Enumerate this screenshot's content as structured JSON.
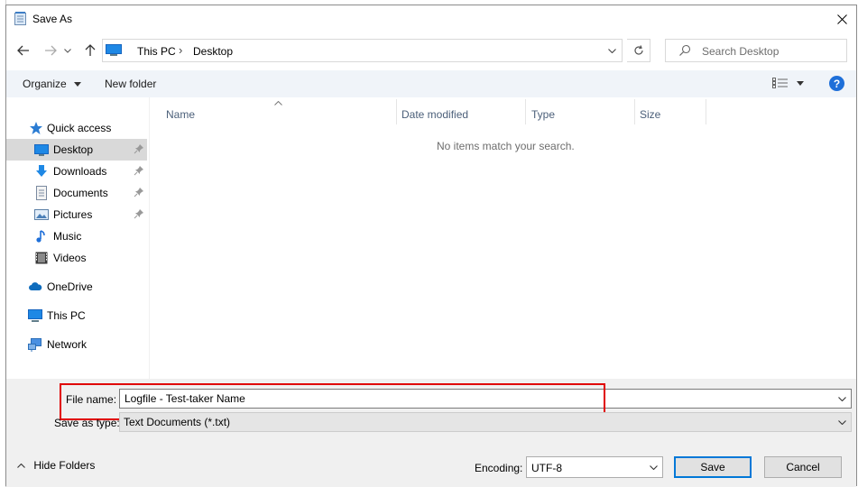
{
  "window": {
    "title": "Save As"
  },
  "nav": {
    "breadcrumb": [
      "This PC",
      "Desktop"
    ],
    "search_placeholder": "Search Desktop"
  },
  "toolbar": {
    "organize_label": "Organize",
    "new_folder_label": "New folder",
    "help_label": "?"
  },
  "sidebar": {
    "items": [
      {
        "label": "Quick access",
        "icon": "star-icon"
      },
      {
        "label": "Desktop",
        "icon": "desktop-icon",
        "pinned": true,
        "selected": true
      },
      {
        "label": "Downloads",
        "icon": "download-icon",
        "pinned": true
      },
      {
        "label": "Documents",
        "icon": "document-icon",
        "pinned": true
      },
      {
        "label": "Pictures",
        "icon": "pictures-icon",
        "pinned": true
      },
      {
        "label": "Music",
        "icon": "music-icon"
      },
      {
        "label": "Videos",
        "icon": "video-icon"
      },
      {
        "label": "OneDrive",
        "icon": "cloud-icon"
      },
      {
        "label": "This PC",
        "icon": "computer-icon"
      },
      {
        "label": "Network",
        "icon": "network-icon"
      }
    ]
  },
  "file_list": {
    "columns": [
      "Name",
      "Date modified",
      "Type",
      "Size"
    ],
    "empty_message": "No items match your search."
  },
  "form": {
    "file_name_label": "File name:",
    "file_name_value": "Logfile - Test-taker Name",
    "save_as_type_label": "Save as type:",
    "save_as_type_value": "Text Documents (*.txt)",
    "encoding_label": "Encoding:",
    "encoding_value": "UTF-8",
    "hide_folders_label": "Hide Folders",
    "save_label": "Save",
    "cancel_label": "Cancel"
  },
  "colors": {
    "highlight_border": "#e00000",
    "toolbar_bg": "#f0f4f9",
    "accent": "#0078d7"
  }
}
